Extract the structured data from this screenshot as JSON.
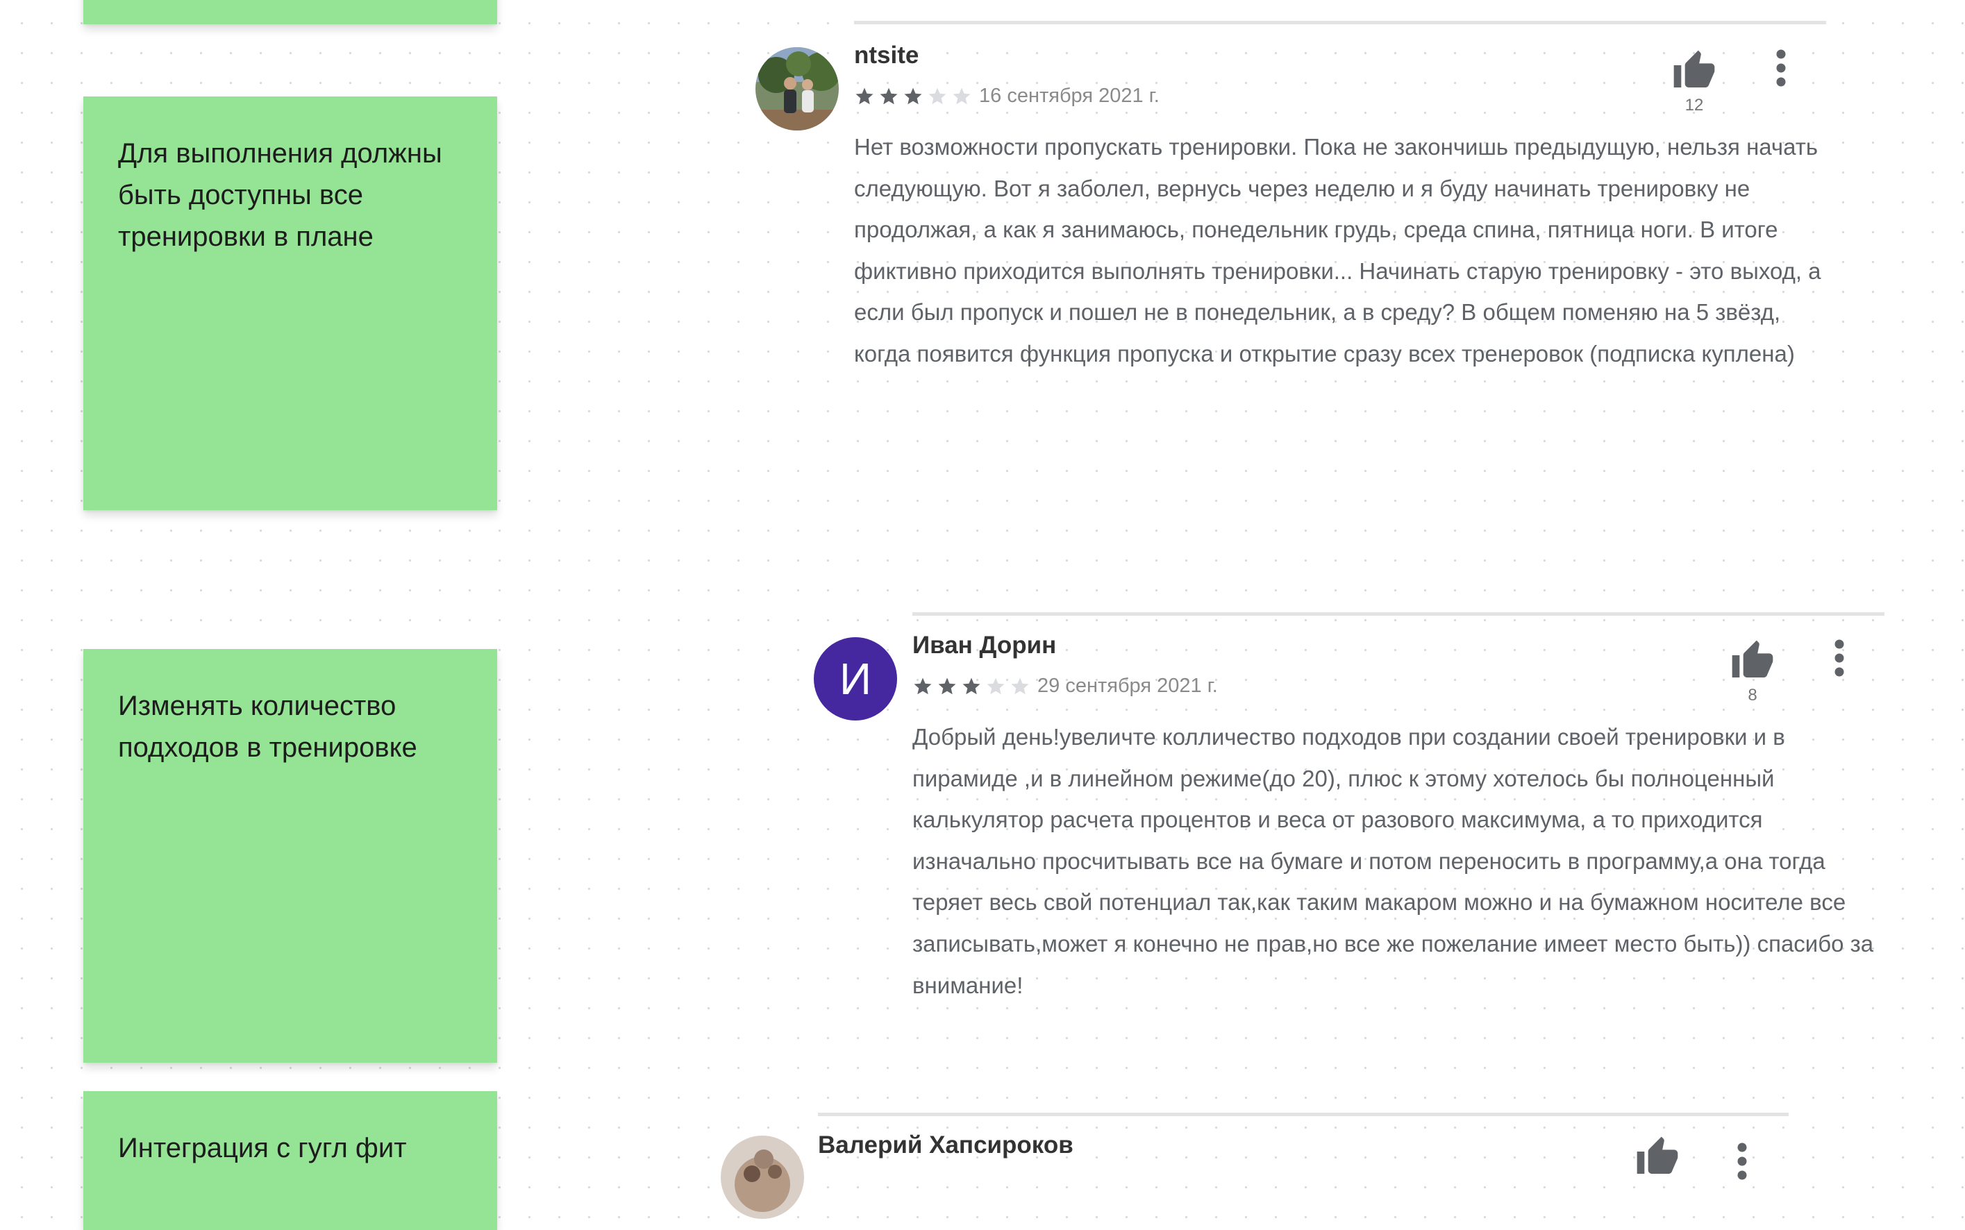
{
  "sticky_notes": [
    {
      "text": ""
    },
    {
      "text": "Для выполнения должны быть доступны все тренировки в плане"
    },
    {
      "text": "Изменять количество подходов в тренировке"
    },
    {
      "text": "Интеграция с гугл фит"
    }
  ],
  "reviews": [
    {
      "author": "ntsite",
      "avatar": "photo",
      "rating": 3,
      "max_rating": 5,
      "date": "16 сентября 2021 г.",
      "text": "Нет возможности пропускать тренировки. Пока не закончишь предыдущую, нельзя начать следующую. Вот я заболел, вернусь через неделю и я буду начинать тренировку не продолжая, а как я занимаюсь, понедельник грудь, среда спина, пятница ноги. В итоге фиктивно приходится выполнять тренировки... Начинать старую тренировку - это выход, а если был пропуск и пошел не в понедельник, а в среду? В общем поменяю на 5 звёзд, когда появится функция пропуска и открытие сразу всех тренеровок (подписка куплена)",
      "likes": "12"
    },
    {
      "author": "Иван Дорин",
      "avatar_letter": "И",
      "avatar_color": "#4527a0",
      "rating": 3,
      "max_rating": 5,
      "date": "29 сентября 2021 г.",
      "text": "Добрый день!увеличте колличество подходов при создании своей тренировки и в пирамиде ,и в линейном режиме(до 20), плюс к этому хотелось бы полноценный калькулятор расчета процентов и веса от разового максимума, а то приходится изначально просчитывать все на бумаге и потом переносить в программу,а она тогда теряет весь свой потенциал так,как таким макаром можно и на бумажном носителе все записывать,может я конечно не прав,но все же пожелание имеет место быть)) спасибо за внимание!",
      "likes": "8"
    },
    {
      "author": "Валерий Хапсироков",
      "avatar": "photo"
    }
  ],
  "icons": {
    "like": "thumb-up-icon",
    "more": "more-vert-icon",
    "star": "star-icon"
  },
  "colors": {
    "sticky_green": "#95e394",
    "star_filled": "#5f6368",
    "star_empty": "#dadce0",
    "icon_gray": "#5f6368"
  }
}
